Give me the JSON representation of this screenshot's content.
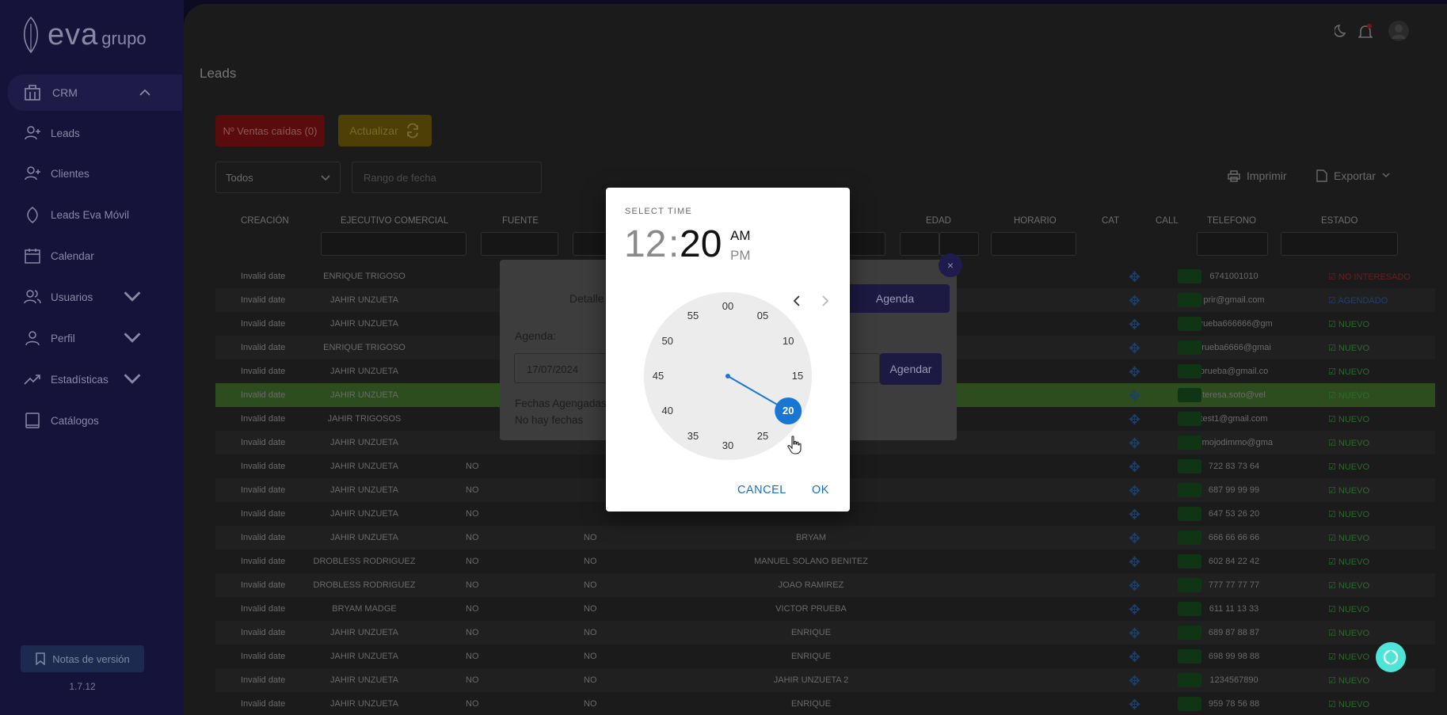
{
  "sidebar": {
    "logo_main": "eva",
    "logo_sub": "grupo",
    "crm_label": "CRM",
    "items": [
      {
        "label": "Leads"
      },
      {
        "label": "Clientes"
      },
      {
        "label": "Leads Eva Móvil"
      },
      {
        "label": "Calendar"
      },
      {
        "label": "Usuarios"
      },
      {
        "label": "Perfil"
      },
      {
        "label": "Estadísticas"
      },
      {
        "label": "Catálogos"
      }
    ],
    "notes_label": "Notas de versión",
    "version": "1.7.12"
  },
  "page": {
    "title": "Leads",
    "btn_ventas": "Nº Ventas caídas (0)",
    "btn_actualizar": "Actualizar",
    "select_todos": "Todos",
    "date_range_placeholder": "Rango de fecha",
    "imprimir": "Imprimir",
    "exportar": "Exportar"
  },
  "table": {
    "headers": {
      "creacion": "CREACIÓN",
      "ejecutivo": "EJECUTIVO COMERCIAL",
      "fuente": "FUENTE",
      "edad": "EDAD",
      "horario": "HORARIO",
      "cat": "CAT",
      "call": "Call",
      "telefono": "TELEFONO",
      "estado": "ESTADO"
    },
    "rows": [
      {
        "creacion": "Invalid date",
        "ejecutivo": "ENRIQUE TRIGOSO",
        "c3": "",
        "c4": "",
        "nombre": "",
        "telefono": "6741001010",
        "estado": "NO INTERESADO"
      },
      {
        "creacion": "Invalid date",
        "ejecutivo": "JAHIR UNZUETA",
        "c3": "",
        "c4": "",
        "nombre": "",
        "telefono": "prir@gmail.com",
        "estado": "AGENDADO"
      },
      {
        "creacion": "Invalid date",
        "ejecutivo": "JAHIR UNZUETA",
        "c3": "",
        "c4": "",
        "nombre": "",
        "telefono": "prueba666666@gm",
        "estado": "NUEVO"
      },
      {
        "creacion": "Invalid date",
        "ejecutivo": "ENRIQUE TRIGOSO",
        "c3": "",
        "c4": "",
        "nombre": "",
        "telefono": "prueba6666@gmai",
        "estado": "NUEVO"
      },
      {
        "creacion": "Invalid date",
        "ejecutivo": "JAHIR UNZUETA",
        "c3": "",
        "c4": "",
        "nombre": "",
        "telefono": "prueba@gmail.co",
        "estado": "NUEVO"
      },
      {
        "creacion": "Invalid date",
        "ejecutivo": "JAHIR UNZUETA",
        "c3": "",
        "c4": "",
        "nombre": "",
        "telefono": "teresa.soto@vel",
        "estado": "NUEVO"
      },
      {
        "creacion": "Invalid date",
        "ejecutivo": "JAHIR TRIGOSOS",
        "c3": "",
        "c4": "",
        "nombre": "",
        "telefono": "test1@gmail.com",
        "estado": "NUEVO"
      },
      {
        "creacion": "Invalid date",
        "ejecutivo": "JAHIR UNZUETA",
        "c3": "",
        "c4": "",
        "nombre": "",
        "telefono": "dimojodimmo@gma",
        "estado": "NUEVO"
      },
      {
        "creacion": "Invalid date",
        "ejecutivo": "JAHIR UNZUETA",
        "c3": "NO",
        "c4": "",
        "nombre": "",
        "telefono": "722 83 73 64",
        "estado": "NUEVO"
      },
      {
        "creacion": "Invalid date",
        "ejecutivo": "JAHIR UNZUETA",
        "c3": "NO",
        "c4": "",
        "nombre": "",
        "telefono": "687 99 99 99",
        "estado": "NUEVO"
      },
      {
        "creacion": "Invalid date",
        "ejecutivo": "JAHIR UNZUETA",
        "c3": "NO",
        "c4": "",
        "nombre": "",
        "telefono": "647 53 26 20",
        "estado": "NUEVO"
      },
      {
        "creacion": "Invalid date",
        "ejecutivo": "JAHIR UNZUETA",
        "c3": "NO",
        "c4": "NO",
        "nombre": "BRYAM",
        "telefono": "666 66 66 66",
        "estado": "NUEVO"
      },
      {
        "creacion": "Invalid date",
        "ejecutivo": "DROBLESS RODRIGUEZ",
        "c3": "NO",
        "c4": "NO",
        "nombre": "MANUEL SOLANO BENITEZ",
        "telefono": "602 84 22 42",
        "estado": "NUEVO"
      },
      {
        "creacion": "Invalid date",
        "ejecutivo": "DROBLESS RODRIGUEZ",
        "c3": "NO",
        "c4": "NO",
        "nombre": "JOAO RAMIREZ",
        "telefono": "777 77 77 77",
        "estado": "NUEVO"
      },
      {
        "creacion": "Invalid date",
        "ejecutivo": "BRYAM MADGE",
        "c3": "NO",
        "c4": "NO",
        "nombre": "VICTOR PRUEBA",
        "telefono": "611 11 13 33",
        "estado": "NUEVO"
      },
      {
        "creacion": "Invalid date",
        "ejecutivo": "JAHIR UNZUETA",
        "c3": "NO",
        "c4": "NO",
        "nombre": "ENRIQUE",
        "telefono": "689 87 88 87",
        "estado": "NUEVO"
      },
      {
        "creacion": "Invalid date",
        "ejecutivo": "JAHIR UNZUETA",
        "c3": "NO",
        "c4": "NO",
        "nombre": "ENRIQUE",
        "telefono": "698 99 98 88",
        "estado": "NUEVO"
      },
      {
        "creacion": "Invalid date",
        "ejecutivo": "JAHIR UNZUETA",
        "c3": "NO",
        "c4": "NO",
        "nombre": "JAHIR UNZUETA 2",
        "telefono": "1234567890",
        "estado": "NUEVO"
      },
      {
        "creacion": "Invalid date",
        "ejecutivo": "JAHIR UNZUETA",
        "c3": "NO",
        "c4": "NO",
        "nombre": "ENRIQUE",
        "telefono": "959 78 56 88",
        "estado": "NUEVO"
      }
    ]
  },
  "detail_modal": {
    "title": "Detalle",
    "agenda_label": "Agenda:",
    "agenda_date": "17/07/2024",
    "fechas_label": "Fechas Agengadas:",
    "no_fechas": "No hay fechas",
    "btn_agenda": "Agenda",
    "btn_agendar": "Agendar",
    "close": "×"
  },
  "time_picker": {
    "title": "SELECT TIME",
    "hours": "12",
    "separator": ":",
    "minutes": "20",
    "am": "AM",
    "pm": "PM",
    "selected_minute": 20,
    "dial_numbers": [
      "00",
      "05",
      "10",
      "15",
      "20",
      "25",
      "30",
      "35",
      "40",
      "45",
      "50",
      "55"
    ],
    "cancel": "CANCEL",
    "ok": "OK"
  },
  "colors": {
    "accent": "#1976d2",
    "sidebar_bg": "#16133b",
    "nuevo": "#2a6a2a",
    "no_interesado": "#6a1e1e"
  }
}
